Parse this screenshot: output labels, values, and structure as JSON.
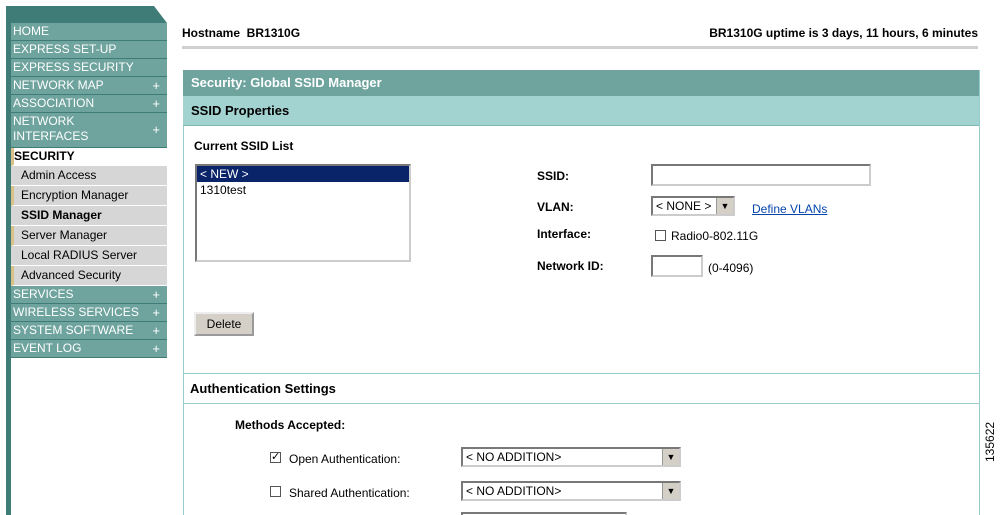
{
  "nav": {
    "items": [
      {
        "label": "HOME",
        "plus": ""
      },
      {
        "label": "EXPRESS SET-UP",
        "plus": ""
      },
      {
        "label": "EXPRESS SECURITY",
        "plus": ""
      },
      {
        "label": "NETWORK MAP",
        "plus": "+"
      },
      {
        "label": "ASSOCIATION",
        "plus": "+"
      },
      {
        "label": "NETWORK INTERFACES",
        "plus": "+"
      },
      {
        "label": "SECURITY",
        "plus": ""
      }
    ],
    "security_sub": [
      "Admin Access",
      "Encryption Manager",
      "SSID Manager",
      "Server Manager",
      "Local RADIUS Server",
      "Advanced Security"
    ],
    "items_after": [
      {
        "label": "SERVICES",
        "plus": "+"
      },
      {
        "label": "WIRELESS SERVICES",
        "plus": "+"
      },
      {
        "label": "SYSTEM SOFTWARE",
        "plus": "+"
      },
      {
        "label": "EVENT LOG",
        "plus": "+"
      }
    ]
  },
  "header": {
    "hostname": "Hostname  BR1310G",
    "uptime": "BR1310G uptime is 3 days, 11 hours, 6 minutes"
  },
  "panel": {
    "title": "Security: Global SSID Manager",
    "subtitle": "SSID Properties"
  },
  "ssid_list": {
    "label": "Current SSID List",
    "options": [
      "< NEW >",
      "1310test"
    ],
    "selected": "< NEW >",
    "delete_label": "Delete"
  },
  "form": {
    "ssid_label": "SSID:",
    "ssid_value": "",
    "vlan_label": "VLAN:",
    "vlan_value": "< NONE >",
    "define_vlans": "Define VLANs",
    "interface_label": "Interface:",
    "interface_option": "Radio0-802.11G",
    "interface_checked": false,
    "network_id_label": "Network ID:",
    "network_id_value": "",
    "network_id_hint": "(0-4096)"
  },
  "auth": {
    "title": "Authentication Settings",
    "methods_label": "Methods Accepted:",
    "open_label": "Open Authentication:",
    "open_checked": true,
    "open_select": "< NO ADDITION>",
    "shared_label": "Shared Authentication:",
    "shared_checked": false,
    "shared_select": "< NO ADDITION>"
  },
  "figure_number": "135622"
}
